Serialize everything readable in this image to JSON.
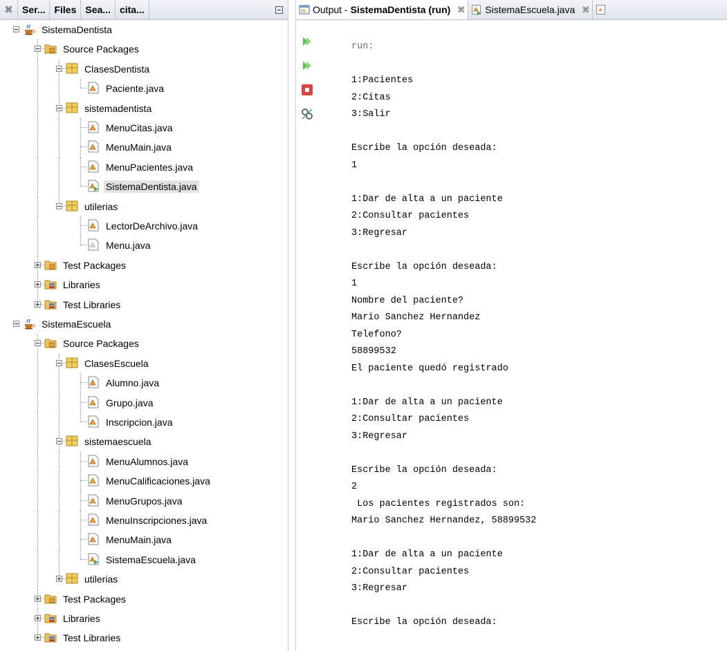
{
  "left_panel": {
    "tabs": [
      {
        "label": "Ser..."
      },
      {
        "label": "Files"
      },
      {
        "label": "Sea..."
      },
      {
        "label": "cita..."
      }
    ],
    "tree": [
      {
        "label": "SistemaDentista",
        "type": "project",
        "depth": 0,
        "toggle": "minus"
      },
      {
        "label": "Source Packages",
        "type": "sourcepkgs",
        "depth": 1,
        "toggle": "minus"
      },
      {
        "label": "ClasesDentista",
        "type": "package",
        "depth": 2,
        "toggle": "minus"
      },
      {
        "label": "Paciente.java",
        "type": "java",
        "depth": 3
      },
      {
        "label": "sistemadentista",
        "type": "package",
        "depth": 2,
        "toggle": "minus"
      },
      {
        "label": "MenuCitas.java",
        "type": "java",
        "depth": 3
      },
      {
        "label": "MenuMain.java",
        "type": "java",
        "depth": 3
      },
      {
        "label": "MenuPacientes.java",
        "type": "java",
        "depth": 3
      },
      {
        "label": "SistemaDentista.java",
        "type": "java-main",
        "depth": 3,
        "selected": true
      },
      {
        "label": "utilerias",
        "type": "package",
        "depth": 2,
        "toggle": "minus"
      },
      {
        "label": "LectorDeArchivo.java",
        "type": "java",
        "depth": 3
      },
      {
        "label": "Menu.java",
        "type": "java-interface",
        "depth": 3
      },
      {
        "label": "Test Packages",
        "type": "testpkgs",
        "depth": 1,
        "toggle": "plus"
      },
      {
        "label": "Libraries",
        "type": "library",
        "depth": 1,
        "toggle": "plus"
      },
      {
        "label": "Test Libraries",
        "type": "library",
        "depth": 1,
        "toggle": "plus"
      },
      {
        "label": "SistemaEscuela",
        "type": "project",
        "depth": 0,
        "toggle": "minus"
      },
      {
        "label": "Source Packages",
        "type": "sourcepkgs",
        "depth": 1,
        "toggle": "minus"
      },
      {
        "label": "ClasesEscuela",
        "type": "package",
        "depth": 2,
        "toggle": "minus"
      },
      {
        "label": "Alumno.java",
        "type": "java",
        "depth": 3
      },
      {
        "label": "Grupo.java",
        "type": "java",
        "depth": 3
      },
      {
        "label": "Inscripcion.java",
        "type": "java",
        "depth": 3
      },
      {
        "label": "sistemaescuela",
        "type": "package",
        "depth": 2,
        "toggle": "minus"
      },
      {
        "label": "MenuAlumnos.java",
        "type": "java",
        "depth": 3
      },
      {
        "label": "MenuCalificaciones.java",
        "type": "java",
        "depth": 3
      },
      {
        "label": "MenuGrupos.java",
        "type": "java",
        "depth": 3
      },
      {
        "label": "MenuInscripciones.java",
        "type": "java",
        "depth": 3
      },
      {
        "label": "MenuMain.java",
        "type": "java",
        "depth": 3
      },
      {
        "label": "SistemaEscuela.java",
        "type": "java-main",
        "depth": 3
      },
      {
        "label": "utilerias",
        "type": "package",
        "depth": 2,
        "toggle": "plus"
      },
      {
        "label": "Test Packages",
        "type": "testpkgs",
        "depth": 1,
        "toggle": "plus"
      },
      {
        "label": "Libraries",
        "type": "library",
        "depth": 1,
        "toggle": "plus"
      },
      {
        "label": "Test Libraries",
        "type": "library",
        "depth": 1,
        "toggle": "plus"
      }
    ]
  },
  "output_panel": {
    "tabs": [
      {
        "prefix": "Output - ",
        "title": "SistemaDentista (run)",
        "active": true
      },
      {
        "title": "SistemaEscuela.java",
        "active": false
      }
    ],
    "toolbar": [
      "rerun-icon",
      "rerun-with-options-icon",
      "stop-icon",
      "settings-icon"
    ],
    "console_lines": [
      "run:",
      "",
      "1:Pacientes",
      "2:Citas",
      "3:Salir",
      "",
      "Escribe la opción deseada:",
      "1",
      "",
      "1:Dar de alta a un paciente",
      "2:Consultar pacientes",
      "3:Regresar",
      "",
      "Escribe la opción deseada:",
      "1",
      "Nombre del paciente?",
      "Mario Sanchez Hernandez",
      "Telefono?",
      "58899532",
      "El paciente quedó registrado",
      "",
      "1:Dar de alta a un paciente",
      "2:Consultar pacientes",
      "3:Regresar",
      "",
      "Escribe la opción deseada:",
      "2",
      " Los pacientes registrados son:",
      "Mario Sanchez Hernandez, 58899532",
      "",
      "1:Dar de alta a un paciente",
      "2:Consultar pacientes",
      "3:Regresar",
      "",
      "Escribe la opción deseada:"
    ]
  }
}
